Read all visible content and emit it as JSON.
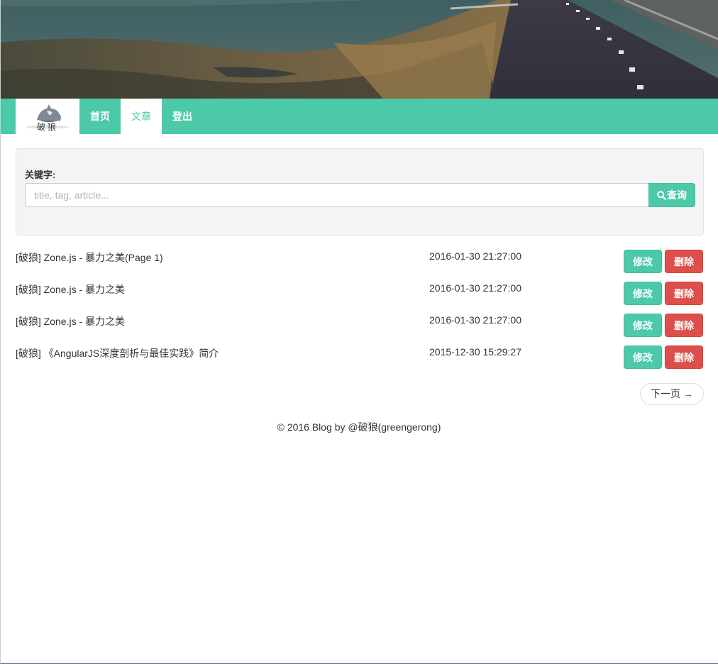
{
  "header": {
    "brand_text": "破狼",
    "nav": [
      {
        "label": "首页",
        "active": false
      },
      {
        "label": "文章",
        "active": true
      },
      {
        "label": "登出",
        "active": false
      }
    ]
  },
  "search": {
    "label": "关键字:",
    "placeholder": "title, tag, article...",
    "value": "",
    "button_label": "查询",
    "button_icon": "search-icon"
  },
  "articles": [
    {
      "title": "[破狼] Zone.js - 暴力之美(Page 1)",
      "date": "2016-01-30 21:27:00",
      "edit_label": "修改",
      "delete_label": "删除"
    },
    {
      "title": "[破狼] Zone.js - 暴力之美",
      "date": "2016-01-30 21:27:00",
      "edit_label": "修改",
      "delete_label": "删除"
    },
    {
      "title": "[破狼] Zone.js - 暴力之美",
      "date": "2016-01-30 21:27:00",
      "edit_label": "修改",
      "delete_label": "删除"
    },
    {
      "title": "[破狼] 《AngularJS深度剖析与最佳实践》简介",
      "date": "2015-12-30 15:29:27",
      "edit_label": "修改",
      "delete_label": "删除"
    }
  ],
  "pager": {
    "next_label": "下一页 →"
  },
  "footer": {
    "text": "© 2016 Blog by @破狼(greengerong)"
  },
  "colors": {
    "primary": "#4cc9a8",
    "danger": "#dc4f4a",
    "panel_bg": "#f4f4f4",
    "text": "#333333"
  }
}
